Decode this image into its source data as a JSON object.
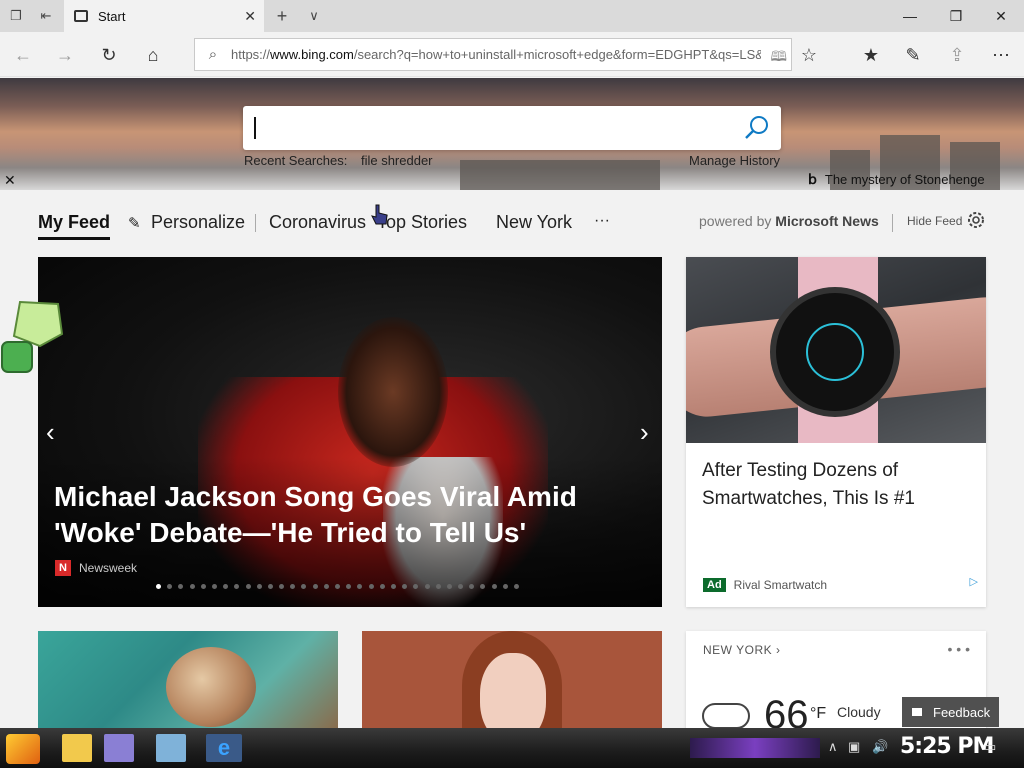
{
  "browser": {
    "tab_title": "Start",
    "url_prefix": "https://",
    "url_host": "www.bing.com",
    "url_rest": "/search?q=how+to+uninstall+microsoft+edge&form=EDGHPT&qs=LS&cvid"
  },
  "search": {
    "recent_label": "Recent Searches:",
    "recent_item": "file shredder",
    "manage_history": "Manage History",
    "image_caption": "The mystery of Stonehenge"
  },
  "feed": {
    "tabs": [
      "My Feed",
      "Personalize",
      "Coronavirus",
      "Top Stories",
      "New York"
    ],
    "more": "···",
    "powered_prefix": "powered by",
    "powered_brand": "Microsoft News",
    "hide_feed": "Hide Feed"
  },
  "main_story": {
    "headline": "Michael Jackson Song Goes Viral Amid 'Woke' Debate—'He Tried to Tell Us'",
    "source": "Newsweek",
    "source_badge": "N",
    "carousel_count": 33,
    "carousel_active_index": 0
  },
  "ad_card": {
    "title": "After Testing Dozens of Smartwatches, This Is #1",
    "tag": "Ad",
    "source": "Rival Smartwatch"
  },
  "weather": {
    "location": "NEW YORK",
    "temp": "66",
    "unit": "°F",
    "condition": "Cloudy"
  },
  "feedback_label": "Feedback",
  "taskbar": {
    "clock": "5:25 PM"
  },
  "colors": {
    "accent": "#0078d7",
    "ad_tag": "#0c6b2c",
    "newsweek": "#d92a2a"
  }
}
